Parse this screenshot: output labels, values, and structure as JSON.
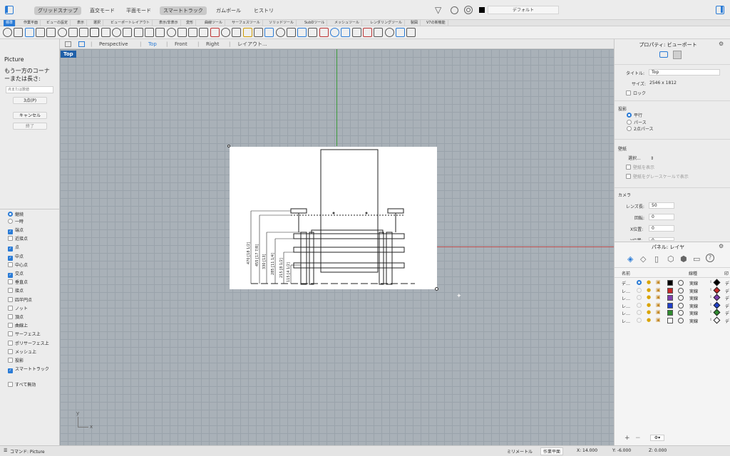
{
  "topbar": {
    "modes": [
      {
        "label": "グリッドスナップ",
        "on": true
      },
      {
        "label": "直交モード",
        "on": false
      },
      {
        "label": "平面モード",
        "on": false
      },
      {
        "label": "スマートトラック",
        "on": true
      },
      {
        "label": "ガムボール",
        "on": false
      },
      {
        "label": "ヒストリ",
        "on": false
      }
    ],
    "layer_name": "デフォルト"
  },
  "tabs": [
    "標準",
    "作業平面",
    "ビューの設定",
    "表示",
    "選択",
    "ビューポートレイアウト",
    "表示/非表示",
    "変形",
    "曲線ツール",
    "サーフェスツール",
    "ソリッドツール",
    "SubDツール",
    "メッシュツール",
    "レンダリングツール",
    "製図",
    "V7の新機能"
  ],
  "left": {
    "title": "Picture",
    "prompt": "もう一方のコーナーまたは長さ:",
    "input_placeholder": "点または数値",
    "btn_3pt": "3点(P)",
    "btn_cancel": "キャンセル",
    "btn_done": "終了",
    "snap_mode": [
      {
        "label": "継続",
        "on": true
      },
      {
        "label": "一時",
        "on": false
      }
    ],
    "snaps": [
      {
        "label": "端点",
        "on": true
      },
      {
        "label": "近接点",
        "on": false
      },
      {
        "label": "点",
        "on": true
      },
      {
        "label": "中点",
        "on": true
      },
      {
        "label": "中心点",
        "on": false
      },
      {
        "label": "交点",
        "on": true
      },
      {
        "label": "垂直点",
        "on": false
      },
      {
        "label": "接点",
        "on": false
      },
      {
        "label": "四半円点",
        "on": false
      },
      {
        "label": "ノット",
        "on": false
      },
      {
        "label": "頂点",
        "on": false
      },
      {
        "label": "曲線上",
        "on": false
      },
      {
        "label": "サーフェス上",
        "on": false
      },
      {
        "label": "ポリサーフェス上",
        "on": false
      },
      {
        "label": "メッシュ上",
        "on": false
      },
      {
        "label": "投影",
        "on": false
      },
      {
        "label": "スマートトラック",
        "on": true
      }
    ],
    "disable_all": "すべて無効"
  },
  "viewport_tabs": {
    "items": [
      "Perspective",
      "Top",
      "Front",
      "Right",
      "レイアウト..."
    ],
    "active": "Top"
  },
  "viewport": {
    "label": "Top",
    "dims": [
      "470 [18 1/2]",
      "455 [17 7/8]",
      "330 [13]",
      "285 [11 1/4]",
      "215 [8 1/2]",
      "115 [4 1/2]"
    ],
    "axis_x": "x",
    "axis_y": "y"
  },
  "right": {
    "title": "プロパティ: ビューポート",
    "title_label": "タイトル:",
    "title_value": "Top",
    "size_label": "サイズ:",
    "size_value": "2546 x 1812",
    "lock_label": "ロック",
    "projection_header": "投影",
    "projections": [
      {
        "label": "平行",
        "on": true
      },
      {
        "label": "パース",
        "on": false
      },
      {
        "label": "2点パース",
        "on": false
      }
    ],
    "wallpaper_header": "壁紙",
    "wallpaper_select": "選択...",
    "wallpaper_show": "壁紙を表示",
    "wallpaper_gray": "壁紙をグレースケールで表示",
    "camera_header": "カメラ",
    "lens_label": "レンズ長:",
    "lens_value": "50",
    "rotation_label": "回転:",
    "rotation_value": "0",
    "xpos_label": "X位置:",
    "xpos_value": "0",
    "ypos_label": "Y位置:",
    "ypos_value": "0",
    "layers_title": "パネル: レイヤ",
    "col_name": "名前",
    "col_linetype": "線種",
    "col_print": "印",
    "layers": [
      {
        "name": "デ…",
        "color": "#000000",
        "linetype": "実線",
        "current": true
      },
      {
        "name": "レ…",
        "color": "#c62828",
        "linetype": "実線",
        "current": false
      },
      {
        "name": "レ…",
        "color": "#7e3fb0",
        "linetype": "実線",
        "current": false
      },
      {
        "name": "レ…",
        "color": "#1f3fc8",
        "linetype": "実線",
        "current": false
      },
      {
        "name": "レ…",
        "color": "#2e8b2e",
        "linetype": "実線",
        "current": false
      },
      {
        "name": "レ…",
        "color": "#ffffff",
        "linetype": "実線",
        "current": false
      }
    ],
    "print_trunc": "デ"
  },
  "status": {
    "command": "コマンド: Picture",
    "unit": "ミリメートル",
    "cplane": "作業平面",
    "x": "X: 14.000",
    "y": "Y: -6.000",
    "z": "Z: 0.000"
  },
  "colors": {
    "accent": "#2a7bd6",
    "green_axis": "#3c9a3c",
    "red_axis": "#c05050"
  }
}
